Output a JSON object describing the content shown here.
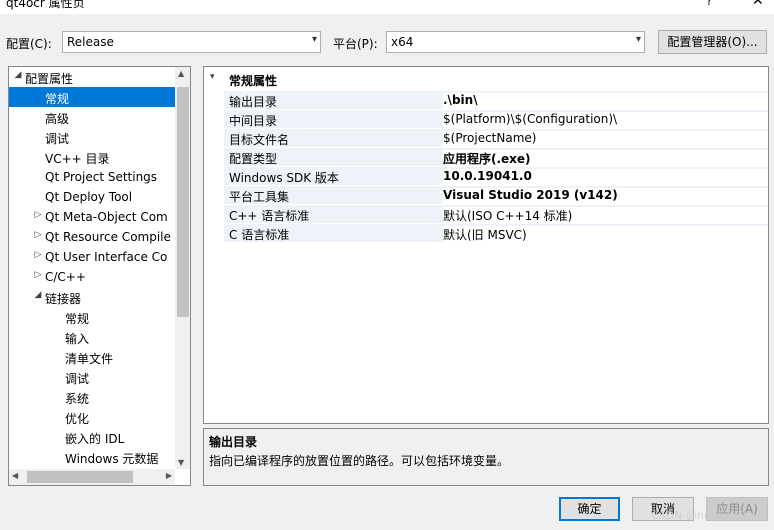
{
  "window": {
    "title": "qt4ocr 属性页",
    "help_glyph": "?",
    "close_glyph": "✕"
  },
  "toolbar": {
    "config_label": "配置(C):",
    "config_value": "Release",
    "platform_label": "平台(P):",
    "platform_value": "x64",
    "config_manager_button": "配置管理器(O)..."
  },
  "tree": {
    "items": [
      {
        "label": "配置属性",
        "level": 0,
        "expander": "◢"
      },
      {
        "label": "常规",
        "level": 1,
        "selected": true
      },
      {
        "label": "高级",
        "level": 1
      },
      {
        "label": "调试",
        "level": 1
      },
      {
        "label": "VC++ 目录",
        "level": 1
      },
      {
        "label": "Qt Project Settings",
        "level": 1
      },
      {
        "label": "Qt Deploy Tool",
        "level": 1
      },
      {
        "label": "Qt Meta-Object Com",
        "level": 1,
        "expander": "▷"
      },
      {
        "label": "Qt Resource Compile",
        "level": 1,
        "expander": "▷"
      },
      {
        "label": "Qt User Interface Co",
        "level": 1,
        "expander": "▷"
      },
      {
        "label": "C/C++",
        "level": 1,
        "expander": "▷"
      },
      {
        "label": "链接器",
        "level": 1,
        "expander": "◢"
      },
      {
        "label": "常规",
        "level": 2
      },
      {
        "label": "输入",
        "level": 2
      },
      {
        "label": "清单文件",
        "level": 2
      },
      {
        "label": "调试",
        "level": 2
      },
      {
        "label": "系统",
        "level": 2
      },
      {
        "label": "优化",
        "level": 2
      },
      {
        "label": "嵌入的 IDL",
        "level": 2
      },
      {
        "label": "Windows 元数据",
        "level": 2
      }
    ]
  },
  "grid": {
    "category": "常规属性",
    "rows": [
      {
        "name": "输出目录",
        "value": ".\\bin\\",
        "bold": true
      },
      {
        "name": "中间目录",
        "value": "$(Platform)\\$(Configuration)\\",
        "bold": false
      },
      {
        "name": "目标文件名",
        "value": "$(ProjectName)",
        "bold": false
      },
      {
        "name": "配置类型",
        "value": "应用程序(.exe)",
        "bold": true
      },
      {
        "name": "Windows SDK 版本",
        "value": "10.0.19041.0",
        "bold": true
      },
      {
        "name": "平台工具集",
        "value": "Visual Studio 2019 (v142)",
        "bold": true
      },
      {
        "name": "C++ 语言标准",
        "value": "默认(ISO C++14 标准)",
        "bold": false
      },
      {
        "name": "C 语言标准",
        "value": "默认(旧 MSVC)",
        "bold": false
      }
    ]
  },
  "description": {
    "title": "输出目录",
    "text": "指向已编译程序的放置位置的路径。可以包括环境变量。"
  },
  "buttons": {
    "ok": "确定",
    "cancel": "取消",
    "apply": "应用(A)"
  },
  "watermark": "CSDN @humour9",
  "colors": {
    "selection": "#0078d7",
    "ok_border": "#0078d7",
    "row_bg": "#eef3fa"
  }
}
